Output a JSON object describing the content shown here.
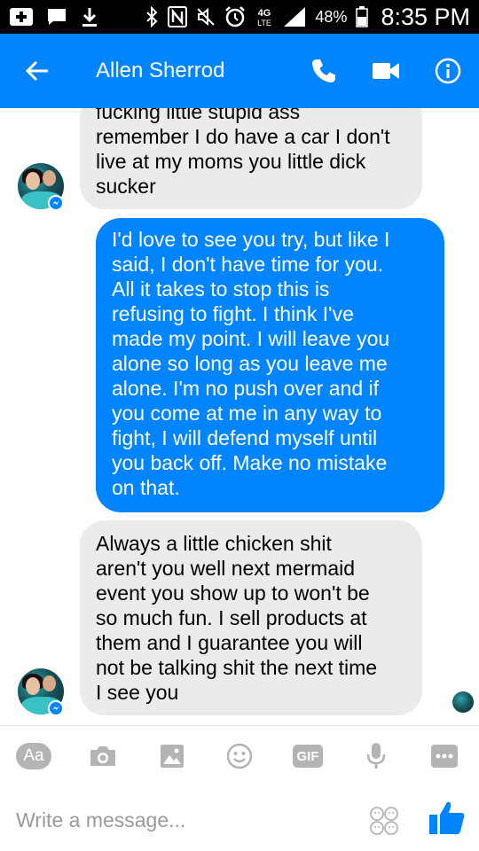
{
  "status_bar": {
    "battery": "48%",
    "time": "8:35 PM",
    "network": "4G LTE"
  },
  "header": {
    "contact_name": "Allen Sherrod"
  },
  "messages": [
    {
      "direction": "incoming",
      "lines": [
        "fucking little stupid ass",
        "remember I do have a car I don't",
        "live at my moms you little dick",
        "sucker"
      ]
    },
    {
      "direction": "outgoing",
      "lines": [
        "I'd love to see you try, but like I",
        "said, I don't have time for you.",
        "All it takes to stop this is",
        "refusing to fight. I think I've",
        "made my point. I will leave you",
        "alone so long as you leave me",
        "alone. I'm no push over and if",
        "you come at me in any way to",
        "fight, I will defend myself until",
        "you back off. Make no mistake",
        "on that."
      ]
    },
    {
      "direction": "incoming",
      "lines": [
        "Always a little chicken shit",
        "aren't you well next mermaid",
        "event you show up to won't be",
        "so much fun. I sell products at",
        "them and I guarantee you will",
        "not be talking shit the next time",
        "I see you"
      ]
    }
  ],
  "composer": {
    "aa_label": "Aa",
    "gif_label": "GIF",
    "placeholder": "Write a message..."
  },
  "colors": {
    "brand": "#0084ff",
    "incoming_bubble": "#ebebeb",
    "icon_gray": "#b4b4b4"
  },
  "icons": [
    "back-arrow-icon",
    "phone-icon",
    "video-camera-icon",
    "info-icon",
    "camera-icon",
    "image-icon",
    "emoji-icon",
    "microphone-icon",
    "more-icon",
    "stickers-icon",
    "thumbs-up-icon"
  ]
}
